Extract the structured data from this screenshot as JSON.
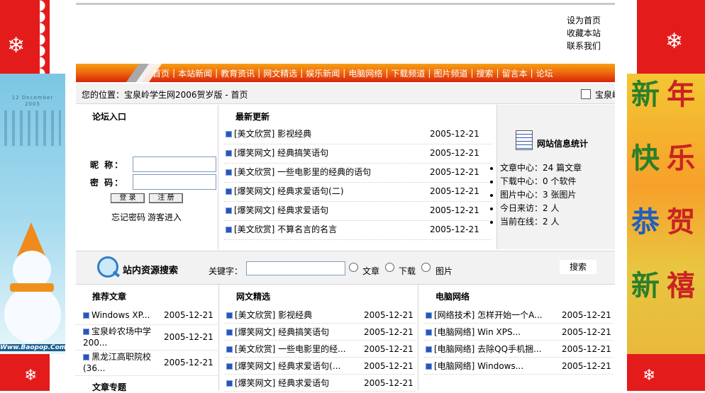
{
  "top_links": [
    "设为首页",
    "收藏本站",
    "联系我们"
  ],
  "nav": [
    "首页",
    "本站新闻",
    "教育资讯",
    "网文精选",
    "娱乐新闻",
    "电脑网络",
    "下载频道",
    "图片频道",
    "搜索",
    "留言本",
    "论坛"
  ],
  "breadcrumb": {
    "text": "您的位置：宝泉岭学生网2006贺岁版 - 首页",
    "right": "宝泉岭"
  },
  "forum": {
    "title": "论坛入口",
    "nickname_label": "昵 称：",
    "password_label": "密 码：",
    "login_button": "登 录",
    "register_button": "注 册",
    "forgot": "忘记密码",
    "guest": "游客进入"
  },
  "latest": {
    "title": "最新更新",
    "items": [
      {
        "title": "[美文欣赏] 影视经典",
        "date": "2005-12-21"
      },
      {
        "title": "[爆笑网文] 经典搞笑语句",
        "date": "2005-12-21"
      },
      {
        "title": "[美文欣赏] 一些电影里的经典的语句",
        "date": "2005-12-21"
      },
      {
        "title": "[爆笑网文] 经典求爱语句(二)",
        "date": "2005-12-21"
      },
      {
        "title": "[爆笑网文] 经典求爱语句",
        "date": "2005-12-21"
      },
      {
        "title": "[美文欣赏] 不算名言的名言",
        "date": "2005-12-21"
      }
    ]
  },
  "stats": {
    "title": "网站信息统计",
    "items": [
      "文章中心：24 篇文章",
      "下载中心：0 个软件",
      "图片中心：3 张图片",
      "今日来访：2 人",
      "当前在线：2 人"
    ]
  },
  "search": {
    "title": "站内资源搜索",
    "keyword_label": "关键字：",
    "keyword_value": "",
    "options": [
      "文章",
      "下载",
      "图片"
    ],
    "button": "搜索"
  },
  "recommended": {
    "title": "推荐文章",
    "items": [
      {
        "title": "Windows XP...",
        "date": "2005-12-21"
      },
      {
        "title": "宝泉岭农场中学200...",
        "date": "2005-12-21"
      },
      {
        "title": "黑龙江高职院校(36...",
        "date": "2005-12-21"
      }
    ],
    "next_title": "文章专题"
  },
  "web_articles": {
    "title": "网文精选",
    "items": [
      {
        "title": "[美文欣赏] 影视经典",
        "date": "2005-12-21"
      },
      {
        "title": "[爆笑网文] 经典搞笑语句",
        "date": "2005-12-21"
      },
      {
        "title": "[美文欣赏] 一些电影里的经...",
        "date": "2005-12-21"
      },
      {
        "title": "[爆笑网文] 经典求爱语句(...",
        "date": "2005-12-21"
      },
      {
        "title": "[爆笑网文] 经典求爱语句",
        "date": "2005-12-21"
      }
    ]
  },
  "computer": {
    "title": "电脑网络",
    "items": [
      {
        "title": "[网络技术] 怎样开始一个A...",
        "date": "2005-12-21"
      },
      {
        "title": "[电脑网络] Win XPS...",
        "date": "2005-12-21"
      },
      {
        "title": "[电脑网络] 去除QQ手机捆...",
        "date": "2005-12-21"
      },
      {
        "title": "[电脑网络] Windows...",
        "date": "2005-12-21"
      }
    ]
  },
  "left_banner": {
    "url": "Www.Baopop.Com",
    "calendar": "12 December 2005"
  },
  "right_banner": {
    "chars": [
      "新",
      "年",
      "快",
      "乐",
      "恭",
      "贺",
      "新",
      "禧"
    ]
  },
  "colors": {
    "nav_top": "#f4a015",
    "nav_bottom": "#d7250a",
    "bullet": "#2b55b5",
    "deco_red": "#e31b1b"
  }
}
